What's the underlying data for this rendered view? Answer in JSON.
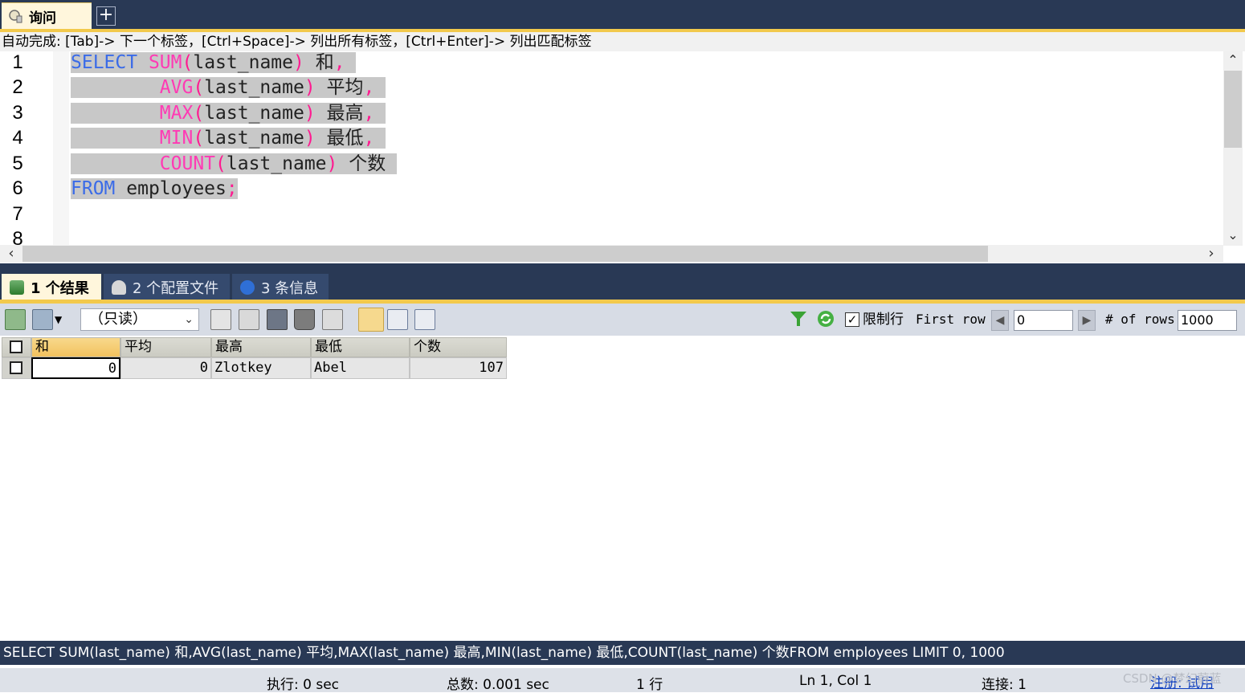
{
  "query_tab": {
    "label": "询问",
    "add_label": "+"
  },
  "autocomplete_hint": "自动完成: [Tab]-> 下一个标签，[Ctrl+Space]-> 列出所有标签，[Ctrl+Enter]-> 列出匹配标签",
  "editor": {
    "line_numbers": [
      "1",
      "2",
      "3",
      "4",
      "5",
      "6",
      "7",
      "8"
    ],
    "code": {
      "l1": {
        "kw": "SELECT",
        "fn": "SUM",
        "open": "(",
        "arg": "last_name",
        "close": ")",
        "alias": "和",
        "comma": ","
      },
      "l2": {
        "fn": "AVG",
        "open": "(",
        "arg": "last_name",
        "close": ")",
        "alias": "平均",
        "comma": ","
      },
      "l3": {
        "fn": "MAX",
        "open": "(",
        "arg": "last_name",
        "close": ")",
        "alias": "最高",
        "comma": ","
      },
      "l4": {
        "fn": "MIN",
        "open": "(",
        "arg": "last_name",
        "close": ")",
        "alias": "最低",
        "comma": ","
      },
      "l5": {
        "fn": "COUNT",
        "open": "(",
        "arg": "last_name",
        "close": ")",
        "alias": "个数"
      },
      "l6": {
        "kw": "FROM",
        "table": "employees",
        "semi": ";"
      }
    }
  },
  "result_tabs": [
    {
      "label": "1 个结果"
    },
    {
      "label": "2 个配置文件"
    },
    {
      "label": "3 条信息"
    }
  ],
  "toolbar": {
    "mode": "（只读）",
    "limit_label": "限制行",
    "limit_checked": true,
    "first_row_label": "First row",
    "first_row_value": "0",
    "rows_label": "# of rows",
    "rows_value": "1000"
  },
  "grid": {
    "columns": [
      "和",
      "平均",
      "最高",
      "最低",
      "个数"
    ],
    "rows": [
      [
        "0",
        "0",
        "Zlotkey",
        "Abel",
        "107"
      ]
    ]
  },
  "sql_status": "SELECT SUM(last_name) 和,AVG(last_name) 平均,MAX(last_name) 最高,MIN(last_name) 最低,COUNT(last_name) 个数FROM employees LIMIT 0, 1000",
  "status": {
    "exec": "执行: 0 sec",
    "total": "总数: 0.001 sec",
    "rows": "1 行",
    "position": "Ln 1, Col 1",
    "connections": "连接: 1",
    "register": "注册: 试用",
    "watermark": "CSDN @梦幻蔚蓝"
  },
  "colors": {
    "chrome": "#293955",
    "accent": "#f2c94c",
    "keyword": "#3a6be8",
    "function": "#ff3ab4",
    "selection": "#c8c8c8"
  }
}
